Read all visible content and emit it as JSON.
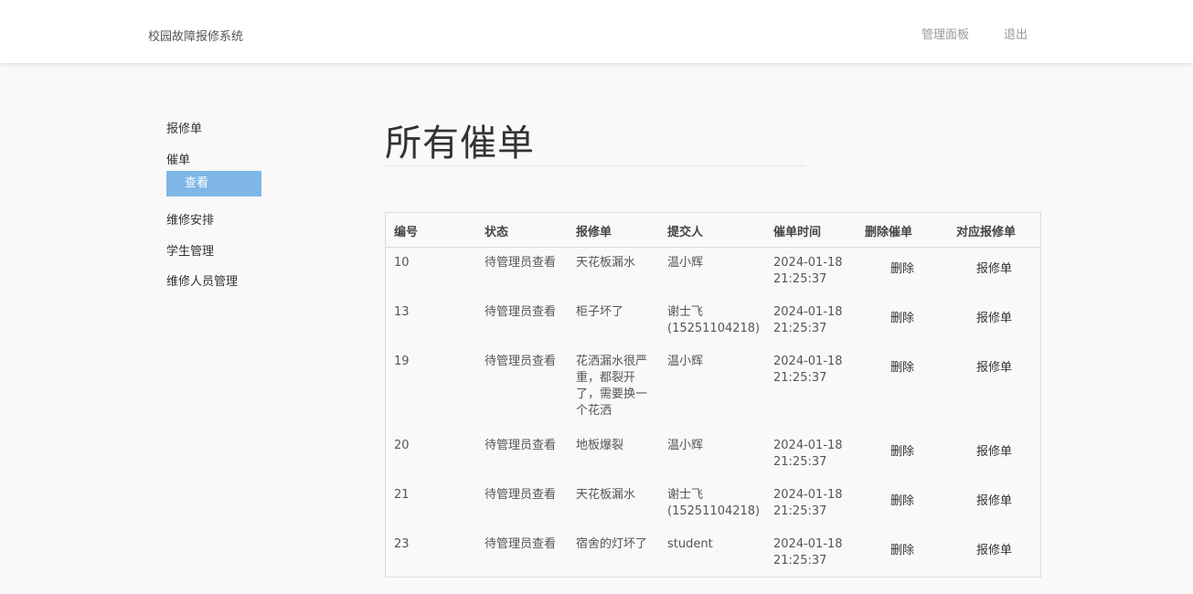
{
  "header": {
    "brand": "校园故障报修系统",
    "dashboard_label": "管理面板",
    "logout_label": "退出"
  },
  "sidebar": {
    "items": [
      {
        "label": "报修单"
      },
      {
        "label": "催单"
      },
      {
        "label": "维修安排"
      },
      {
        "label": "学生管理"
      },
      {
        "label": "维修人员管理"
      }
    ],
    "sub_item": "查看"
  },
  "main": {
    "title": "所有催单",
    "columns": [
      "编号",
      "状态",
      "报修单",
      "提交人",
      "催单时间",
      "删除催单",
      "对应报修单"
    ],
    "rows": [
      {
        "id": "10",
        "status": "待管理员查看",
        "order": "天花板漏水",
        "submitter": "温小辉",
        "time": "2024-01-18 21:25:37",
        "delete": "删除",
        "link": "报修单"
      },
      {
        "id": "13",
        "status": "待管理员查看",
        "order": "柜子坏了",
        "submitter": "谢士飞 (15251104218)",
        "time": "2024-01-18 21:25:37",
        "delete": "删除",
        "link": "报修单"
      },
      {
        "id": "19",
        "status": "待管理员查看",
        "order": "花洒漏水很严重，都裂开了，需要换一个花洒",
        "submitter": "温小辉",
        "time": "2024-01-18 21:25:37",
        "delete": "删除",
        "link": "报修单"
      },
      {
        "id": "20",
        "status": "待管理员查看",
        "order": "地板爆裂",
        "submitter": "温小辉",
        "time": "2024-01-18 21:25:37",
        "delete": "删除",
        "link": "报修单"
      },
      {
        "id": "21",
        "status": "待管理员查看",
        "order": "天花板漏水",
        "submitter": "谢士飞 (15251104218)",
        "time": "2024-01-18 21:25:37",
        "delete": "删除",
        "link": "报修单"
      },
      {
        "id": "23",
        "status": "待管理员查看",
        "order": "宿舍的灯坏了",
        "submitter": "student",
        "time": "2024-01-18 21:25:37",
        "delete": "删除",
        "link": "报修单"
      }
    ]
  }
}
